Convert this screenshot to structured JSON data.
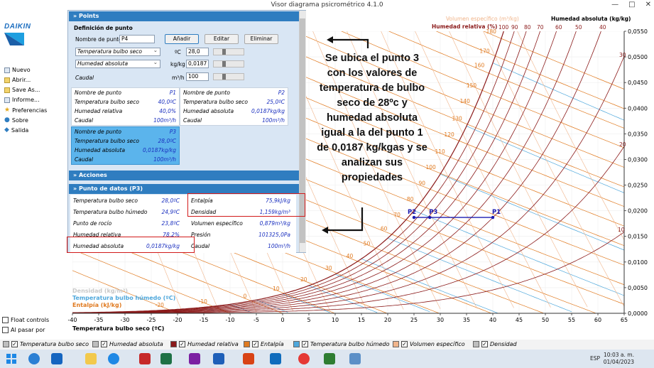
{
  "window": {
    "title": "Visor diagrama psicrométrico 4.1.0",
    "min": "—",
    "max": "□",
    "close": "✕"
  },
  "sidebar": {
    "logo_text": "DAIKIN",
    "items": [
      {
        "label": "Nuevo",
        "icon": "new-file-icon"
      },
      {
        "label": "Abrir...",
        "icon": "open-folder-icon"
      },
      {
        "label": "Save As...",
        "icon": "save-icon"
      },
      {
        "label": "Informe...",
        "icon": "report-icon"
      },
      {
        "label": "Preferencias",
        "icon": "preferences-icon"
      },
      {
        "label": "Sobre",
        "icon": "info-icon"
      },
      {
        "label": "Salida",
        "icon": "exit-icon"
      }
    ],
    "float_controls": "Float controls",
    "al_pasar": "Al pasar por"
  },
  "panel": {
    "points_header": "Points",
    "definicion": "Definición de punto",
    "nombre_label": "Nombre de punto",
    "nombre_value": "P4",
    "add": "Añadir",
    "edit": "Editar",
    "delete": "Eliminar",
    "select1": "Temperatura bulbo seco",
    "unit1": "ºC",
    "val1": "28,0",
    "select2": "Humedad absoluta",
    "unit2": "kg/kg",
    "val2": "0,0187",
    "caudal_label": "Caudal",
    "caudal_unit": "m³/h",
    "caudal_value": "100",
    "p1": [
      [
        "Nombre de punto",
        "P1"
      ],
      [
        "Temperatura bulbo seco",
        "40,0ºC"
      ],
      [
        "Humedad relativa",
        "40,0%"
      ],
      [
        "Caudal",
        "100m³/h"
      ]
    ],
    "p2": [
      [
        "Nombre de punto",
        "P2"
      ],
      [
        "Temperatura bulbo seco",
        "25,0ºC"
      ],
      [
        "Humedad absoluta",
        "0,0187kg/kg"
      ],
      [
        "Caudal",
        "100m³/h"
      ]
    ],
    "p3": [
      [
        "Nombre de punto",
        "P3"
      ],
      [
        "Temperatura bulbo seco",
        "28,0ºC"
      ],
      [
        "Humedad absoluta",
        "0,0187kg/kg"
      ],
      [
        "Caudal",
        "100m³/h"
      ]
    ],
    "acciones_header": "Acciones",
    "datos_header": "Punto de datos (P3)",
    "datos_left": [
      [
        "Temperatura bulbo seco",
        "28,0ºC"
      ],
      [
        "Temperatura bulbo húmedo",
        "24,9ºC"
      ],
      [
        "Punto de rocío",
        "23,8ºC"
      ],
      [
        "Humedad relativa",
        "78,2%"
      ],
      [
        "Humedad absoluta",
        "0,0187kg/kg"
      ]
    ],
    "datos_right": [
      [
        "Entalpía",
        "75,9kJ/kg"
      ],
      [
        "Densidad",
        "1,159kg/m³"
      ],
      [
        "Volumen específico",
        "0,879m³/kg"
      ],
      [
        "Presión",
        "101325,0Pa"
      ],
      [
        "Caudal",
        "100m³/h"
      ]
    ]
  },
  "annotation": "Se ubica el punto 3 con los valores de temperatura de bulbo seco de 28ºc y humedad absoluta igual a la del punto 1  de 0,0187 kg/kgas y se analizan sus propiedades",
  "chart": {
    "top_label_vol": "Volumen específico (m³/kg)",
    "top_label_abs": "Humedad absoluta (kg/kg)",
    "top_label_rh": "Humedad relativa (%)",
    "left_label_dens": "Densidad (kg/m³)",
    "left_label_wb": "Temperatura bulbo húmedo (ºC)",
    "left_label_ent": "Entalpía (kJ/kg)",
    "xlabel": "Temperatura bulbo seco (ºC)",
    "colors": {
      "rh": "#8b1a1a",
      "enthalpy": "#e07a20",
      "wetbulb": "#4fa8dc",
      "volume": "#f0b48a",
      "points": "#1b1bb0"
    }
  },
  "chart_data": {
    "type": "line",
    "title": "",
    "xlabel": "Temperatura bulbo seco (ºC)",
    "ylabel": "Humedad absoluta (kg/kg)",
    "xlim": [
      -40,
      65
    ],
    "ylim": [
      0,
      0.055
    ],
    "x_ticks": [
      "-40",
      "-35",
      "-30",
      "-25",
      "-20",
      "-15",
      "-10",
      "-5",
      "0",
      "5",
      "10",
      "15",
      "20",
      "25",
      "30",
      "35",
      "40",
      "45",
      "50",
      "55",
      "60",
      "65"
    ],
    "y_ticks": [
      "0,0000",
      "0,0050",
      "0,0100",
      "0,0150",
      "0,0200",
      "0,0250",
      "0,0300",
      "0,0350",
      "0,0400",
      "0,0450",
      "0,0500",
      "0,0550"
    ],
    "rh_labels": [
      "100",
      "90",
      "80",
      "70",
      "60",
      "50",
      "40",
      "30",
      "20",
      "10"
    ],
    "enthalpy_labels": [
      "-20",
      "-10",
      "0",
      "10",
      "20",
      "30",
      "40",
      "50",
      "60",
      "70",
      "80",
      "90",
      "100",
      "110",
      "120",
      "130",
      "140",
      "150",
      "160",
      "170",
      "180"
    ],
    "points": [
      {
        "name": "P1",
        "x": 40,
        "y": 0.0187
      },
      {
        "name": "P2",
        "x": 25,
        "y": 0.0187
      },
      {
        "name": "P3",
        "x": 28,
        "y": 0.0187
      }
    ]
  },
  "legend": [
    {
      "label": "Temperatura bulbo seco",
      "color": "#bdbdbd"
    },
    {
      "label": "Humedad absoluta",
      "color": "#bdbdbd"
    },
    {
      "label": "Humedad relativa",
      "color": "#8b1a1a"
    },
    {
      "label": "Entalpía",
      "color": "#e07a20"
    },
    {
      "label": "Temperatura bulbo húmedo",
      "color": "#4fa8dc"
    },
    {
      "label": "Volumen específico",
      "color": "#f0b48a"
    },
    {
      "label": "Densidad",
      "color": "#bdbdbd"
    }
  ],
  "taskbar": {
    "time": "10:03 a. m.",
    "date": "01/04/2023",
    "lang": "ESP"
  }
}
